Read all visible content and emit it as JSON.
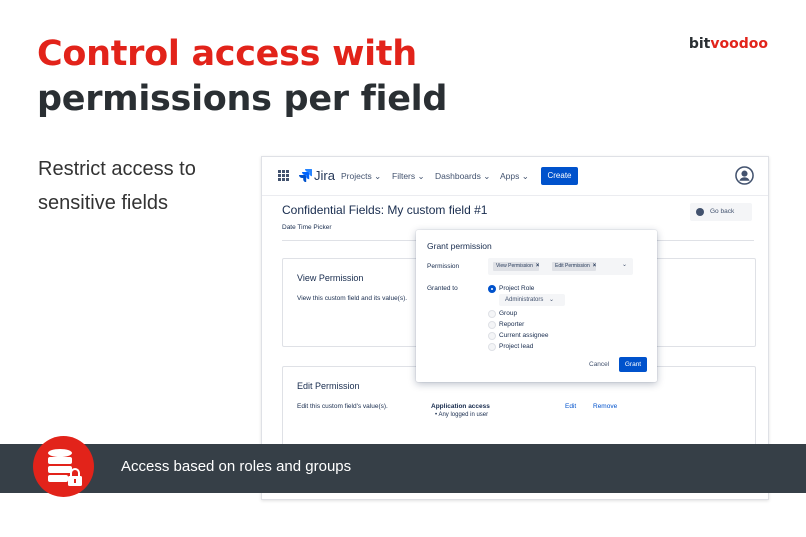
{
  "slide": {
    "title_line1": "Control access with",
    "title_line2": "permissions per field",
    "logo_prefix": "bit",
    "logo_accent": "voodoo",
    "subtitle": "Restrict access to sensitive fields",
    "banner_text": "Access based on roles and groups"
  },
  "jira": {
    "brand": "Jira",
    "nav": [
      "Projects",
      "Filters",
      "Dashboards",
      "Apps"
    ],
    "create_label": "Create",
    "page_title": "Confidential Fields: My custom field #1",
    "field_type": "Date Time Picker",
    "go_back_label": "Go back",
    "view_card": {
      "title": "View Permission",
      "desc": "View this custom field and its value(s)."
    },
    "edit_card": {
      "title": "Edit Permission",
      "desc": "Edit this custom field's value(s).",
      "access_title": "Application access",
      "access_item": "Any logged in user",
      "edit_label": "Edit",
      "remove_label": "Remove"
    },
    "modal": {
      "title": "Grant permission",
      "permission_label": "Permission",
      "tags": [
        "View Permission",
        "Edit Permission"
      ],
      "granted_label": "Granted to",
      "role_select": "Administrators",
      "options": [
        "Project Role",
        "Group",
        "Reporter",
        "Current assignee",
        "Project lead"
      ],
      "selected_option": "Project Role",
      "cancel_label": "Cancel",
      "grant_label": "Grant"
    }
  },
  "colors": {
    "brand_red": "#e2231a",
    "dark_text": "#2a2f33",
    "jira_blue": "#0052cc",
    "banner_bg": "#363f47"
  },
  "icons": {
    "app_switcher": "grid-icon",
    "jira_logo": "jira-logo-icon",
    "avatar": "user-avatar-icon",
    "go_back": "arrow-left-circle-icon",
    "banner": "database-lock-icon"
  }
}
